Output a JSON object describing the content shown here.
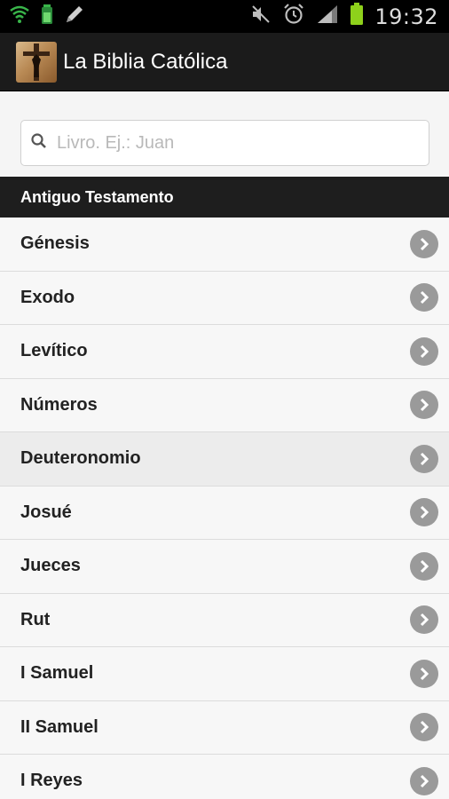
{
  "status_bar": {
    "time": "19:32",
    "left_icons": [
      "wifi-icon",
      "battery-usb-icon",
      "pencil-icon"
    ],
    "right_icons": [
      "mute-icon",
      "alarm-icon",
      "signal-icon",
      "battery-icon"
    ]
  },
  "app_bar": {
    "title": "La Biblia Católica",
    "logo": "crucifix-logo"
  },
  "search": {
    "placeholder": "Livro. Ej.: Juan",
    "value": "",
    "icon": "search-icon"
  },
  "section": {
    "title": "Antiguo Testamento"
  },
  "books": [
    {
      "label": "Génesis"
    },
    {
      "label": "Exodo"
    },
    {
      "label": "Levítico"
    },
    {
      "label": "Números"
    },
    {
      "label": "Deuteronomio"
    },
    {
      "label": "Josué"
    },
    {
      "label": "Jueces"
    },
    {
      "label": "Rut"
    },
    {
      "label": "I Samuel"
    },
    {
      "label": "II Samuel"
    },
    {
      "label": "I Reyes"
    }
  ],
  "colors": {
    "app_bar": "#1b1b1b",
    "section_header": "#1e1e1e",
    "chevron": "#9a9a9a",
    "battery": "#8ed11b"
  }
}
